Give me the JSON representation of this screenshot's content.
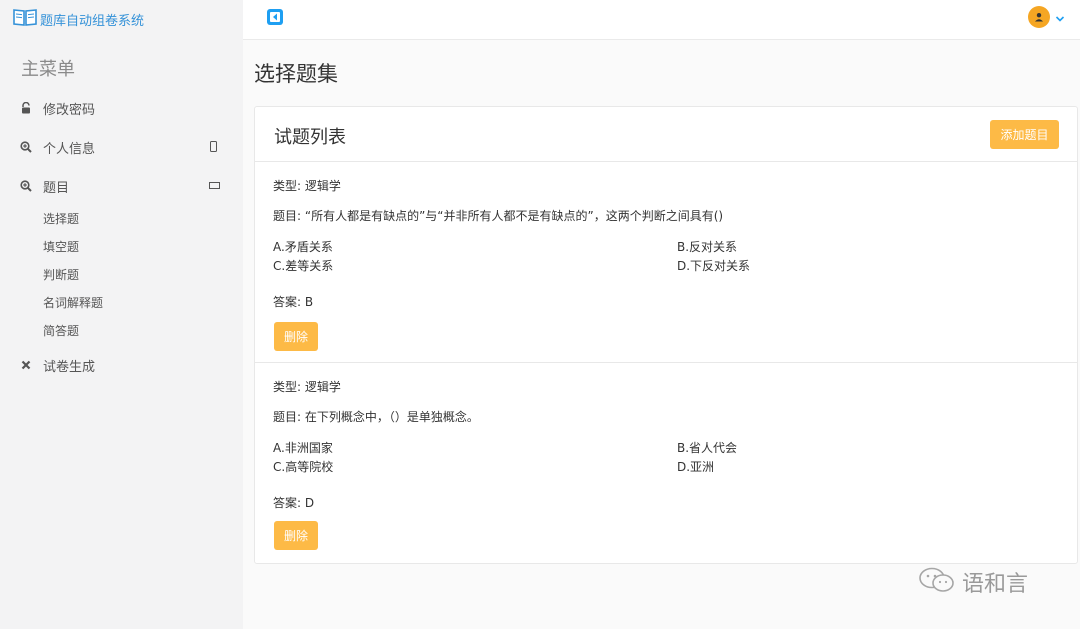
{
  "brand": {
    "title": "题库自动组卷系统",
    "icon": "book-icon"
  },
  "sidebar": {
    "menu_title": "主菜单",
    "items": [
      {
        "label": "修改密码",
        "icon": "lock-icon"
      },
      {
        "label": "个人信息",
        "icon": "search-plus-icon",
        "tail": "mobile-icon"
      },
      {
        "label": "题目",
        "icon": "search-plus-icon",
        "tail": "laptop-icon"
      },
      {
        "label": "试卷生成",
        "icon": "close-icon"
      }
    ],
    "sub_items": [
      "选择题",
      "填空题",
      "判断题",
      "名词解释题",
      "简答题"
    ]
  },
  "topbar": {
    "toggle_icon": "caret-square-left-icon",
    "user_icon": "user-icon",
    "dropdown_icon": "chevron-down-icon"
  },
  "main": {
    "page_title": "选择题集",
    "card_title": "试题列表",
    "add_button": "添加题目",
    "questions": [
      {
        "type": "类型: 逻辑学",
        "stem": "题目: “所有人都是有缺点的”与“并非所有人都不是有缺点的”，这两个判断之间具有()",
        "options": [
          "A.矛盾关系",
          "B.反对关系",
          "C.差等关系",
          "D.下反对关系"
        ],
        "answer": "答案: B",
        "delete_label": "删除"
      },
      {
        "type": "类型: 逻辑学",
        "stem": "题目: 在下列概念中，（）是单独概念。",
        "options": [
          "A.非洲国家",
          "B.省人代会",
          "C.高等院校",
          "D.亚洲"
        ],
        "answer": "答案: D",
        "delete_label": "删除"
      }
    ]
  },
  "watermark": {
    "text": "语和言",
    "icon": "wechat-icon"
  },
  "colors": {
    "accent": "#3592d8",
    "warning": "#fdba46",
    "avatar": "#f5a623",
    "sidebar_bg": "#f3f3f4"
  }
}
